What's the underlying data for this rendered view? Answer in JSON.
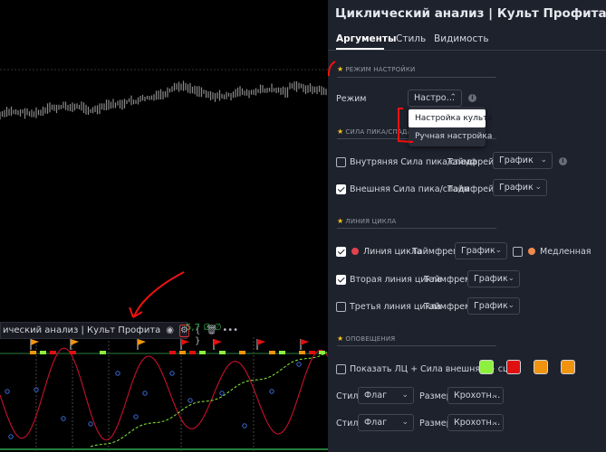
{
  "chart": {
    "legend_title": "ический анализ | Культ Профита",
    "legend_values": "5,7 ∅ ∅",
    "icons": [
      "eye-icon",
      "gear-icon",
      "braces-icon",
      "trash-icon",
      "more-icon"
    ]
  },
  "panel": {
    "title": "Циклический анализ | Культ Профита",
    "tabs": [
      {
        "label": "Аргументы",
        "active": true
      },
      {
        "label": "Стиль",
        "active": false
      },
      {
        "label": "Видимость",
        "active": false
      }
    ],
    "sections": {
      "mode": "РЕЖИМ НАСТРОЙКИ",
      "strength": "СИЛА ПИКА/СПАДА",
      "cycle_line": "ЛИНИЯ ЦИКЛА",
      "alerts": "ОПОВЕЩЕНИЯ"
    },
    "mode": {
      "label": "Режим",
      "value": "Настро…",
      "options": [
        "Настройка культа",
        "Ручная настройка"
      ]
    },
    "strength_rows": [
      {
        "label": "Внутряняя Сила пика/спада",
        "checked": false,
        "tf_label": "Таймфрейм",
        "tf_value": "График"
      },
      {
        "label": "Внешняя Сила пика/спада",
        "checked": true,
        "tf_label": "Таймфрейм",
        "tf_value": "График"
      }
    ],
    "cycle_rows": [
      {
        "label": "Линия цикла",
        "checked": true,
        "tf_label": "Таймфрем",
        "tf_value": "График",
        "color": "#e0434f"
      },
      {
        "label": "Вторая линия цикла",
        "checked": true,
        "tf_label": "Таймфрем",
        "tf_value": "График"
      },
      {
        "label": "Третья линия цикла",
        "checked": false,
        "tf_label": "Таймфрем",
        "tf_value": "График"
      }
    ],
    "slow": {
      "label": "Медленная",
      "checked": false,
      "color": "#f08a4b"
    },
    "alerts": {
      "show_label": "Показать ЛЦ + Сила внешняя + сц",
      "show_checked": false,
      "colors": [
        "#8cf03c",
        "#e01010",
        "#f0940f",
        "#f0940f"
      ],
      "rows": [
        {
          "style_label": "Стиль",
          "style_value": "Флаг",
          "size_label": "Размер",
          "size_value": "Крохотн…"
        },
        {
          "style_label": "Стиль",
          "style_value": "Флаг",
          "size_label": "Размер",
          "size_value": "Крохотн…"
        }
      ]
    }
  }
}
